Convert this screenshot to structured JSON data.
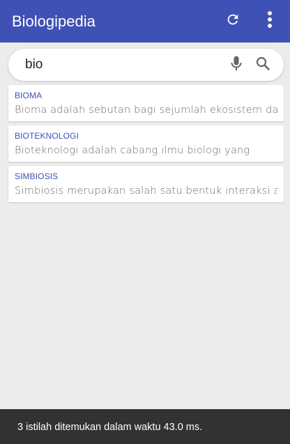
{
  "appbar": {
    "title": "Biologipedia",
    "refresh_icon": "refresh-icon",
    "menu_icon": "more-vert-icon",
    "color": "#3f51b5"
  },
  "search": {
    "value": "bio",
    "mic_icon": "mic-icon",
    "search_icon": "search-icon"
  },
  "results": [
    {
      "title": "BIOMA",
      "desc": "Bioma adalah sebutan bagi sejumlah ekosistem darat"
    },
    {
      "title": "BIOTEKNOLOGI",
      "desc": "Bioteknologi adalah cabang ilmu biologi yang"
    },
    {
      "title": "SIMBIOSIS",
      "desc": "Simbiosis merupakan salah satu bentuk interaksi antar"
    }
  ],
  "snackbar": {
    "text": "3 istilah ditemukan dalam waktu 43.0 ms."
  }
}
